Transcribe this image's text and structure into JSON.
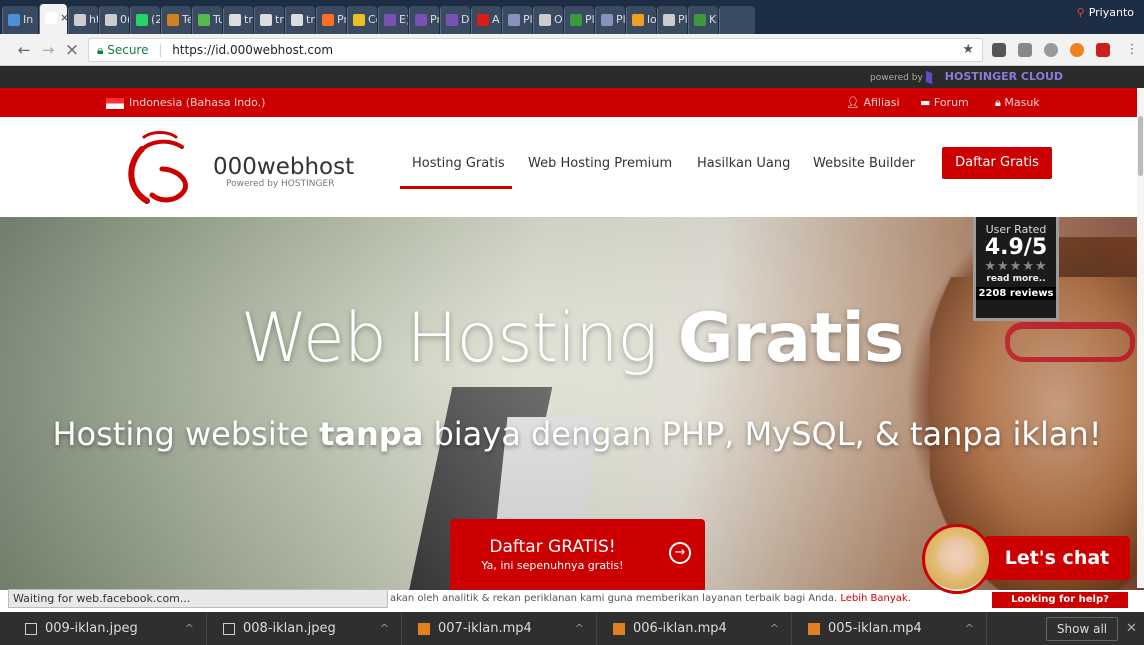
{
  "browser": {
    "tabs": [
      {
        "label": "In",
        "color": "#4a90d9"
      },
      {
        "label": "×",
        "color": "#ffffff",
        "active": true
      },
      {
        "label": "ht",
        "color": "#cccccc"
      },
      {
        "label": "0(",
        "color": "#cccccc"
      },
      {
        "label": "(2",
        "color": "#25d366"
      },
      {
        "label": "Te",
        "color": "#d08020"
      },
      {
        "label": "Tu",
        "color": "#57b84b"
      },
      {
        "label": "tr",
        "color": "#dddddd"
      },
      {
        "label": "tr",
        "color": "#dddddd"
      },
      {
        "label": "tr",
        "color": "#dddddd"
      },
      {
        "label": "Pr",
        "color": "#fc6d26"
      },
      {
        "label": "Co",
        "color": "#e8c020"
      },
      {
        "label": "E)",
        "color": "#7952b3"
      },
      {
        "label": "Pr",
        "color": "#7952b3"
      },
      {
        "label": "D",
        "color": "#7952b3"
      },
      {
        "label": "A",
        "color": "#dd1b16"
      },
      {
        "label": "Pl",
        "color": "#8892bf"
      },
      {
        "label": "O",
        "color": "#cccccc"
      },
      {
        "label": "Pl",
        "color": "#3c9a3c"
      },
      {
        "label": "Pl",
        "color": "#8892bf"
      },
      {
        "label": "lo",
        "color": "#f0a020"
      },
      {
        "label": "Pl",
        "color": "#cccccc"
      },
      {
        "label": "K",
        "color": "#3c9a3c"
      },
      {
        "label": "",
        "color": "#3a4a60"
      }
    ],
    "profile_name": "Priyanto",
    "url_secure_label": "Secure",
    "url": "https://id.000webhost.com",
    "star_icon": "★",
    "back_icon": "←",
    "forward_icon": "→",
    "stop_icon": "×"
  },
  "powered": {
    "text": "powered by",
    "brand": "HOSTINGER CLOUD"
  },
  "topbar": {
    "language": "Indonesia (Bahasa Indo.)",
    "affiliate": "Afiliasi",
    "forum": "Forum",
    "login": "Masuk"
  },
  "header": {
    "brand": "000webhost",
    "brand_sub": "Powered by HOSTINGER",
    "menu": {
      "free": "Hosting Gratis",
      "premium": "Web Hosting Premium",
      "earn": "Hasilkan Uang",
      "builder": "Website Builder"
    },
    "signup": "Daftar Gratis"
  },
  "hero": {
    "title_light": "Web Hosting ",
    "title_bold": "Gratis",
    "sub_a": "Hosting website ",
    "sub_bold": "tanpa",
    "sub_b": " biaya dengan PHP, MySQL, & tanpa iklan!",
    "cta_main": "Daftar GRATIS!",
    "cta_sub": "Ya, ini sepenuhnya gratis!",
    "cta_icon": "→"
  },
  "rating": {
    "label": "User Rated",
    "score": "4.9/5",
    "stars": "★★★★★",
    "read_more": "read more..",
    "reviews": "2208 reviews"
  },
  "cookie": {
    "text": "akan oleh analitik & rekan periklanan kami guna memberikan layanan terbaik bagi Anda. ",
    "link": "Lebih Banyak."
  },
  "status": "Waiting for web.facebook.com...",
  "chat": {
    "bubble": "Let's chat",
    "help": "Looking for help?"
  },
  "downloads": {
    "items": [
      "009-iklan.jpeg",
      "008-iklan.jpeg",
      "007-iklan.mp4",
      "006-iklan.mp4",
      "005-iklan.mp4"
    ],
    "show_all": "Show all"
  }
}
